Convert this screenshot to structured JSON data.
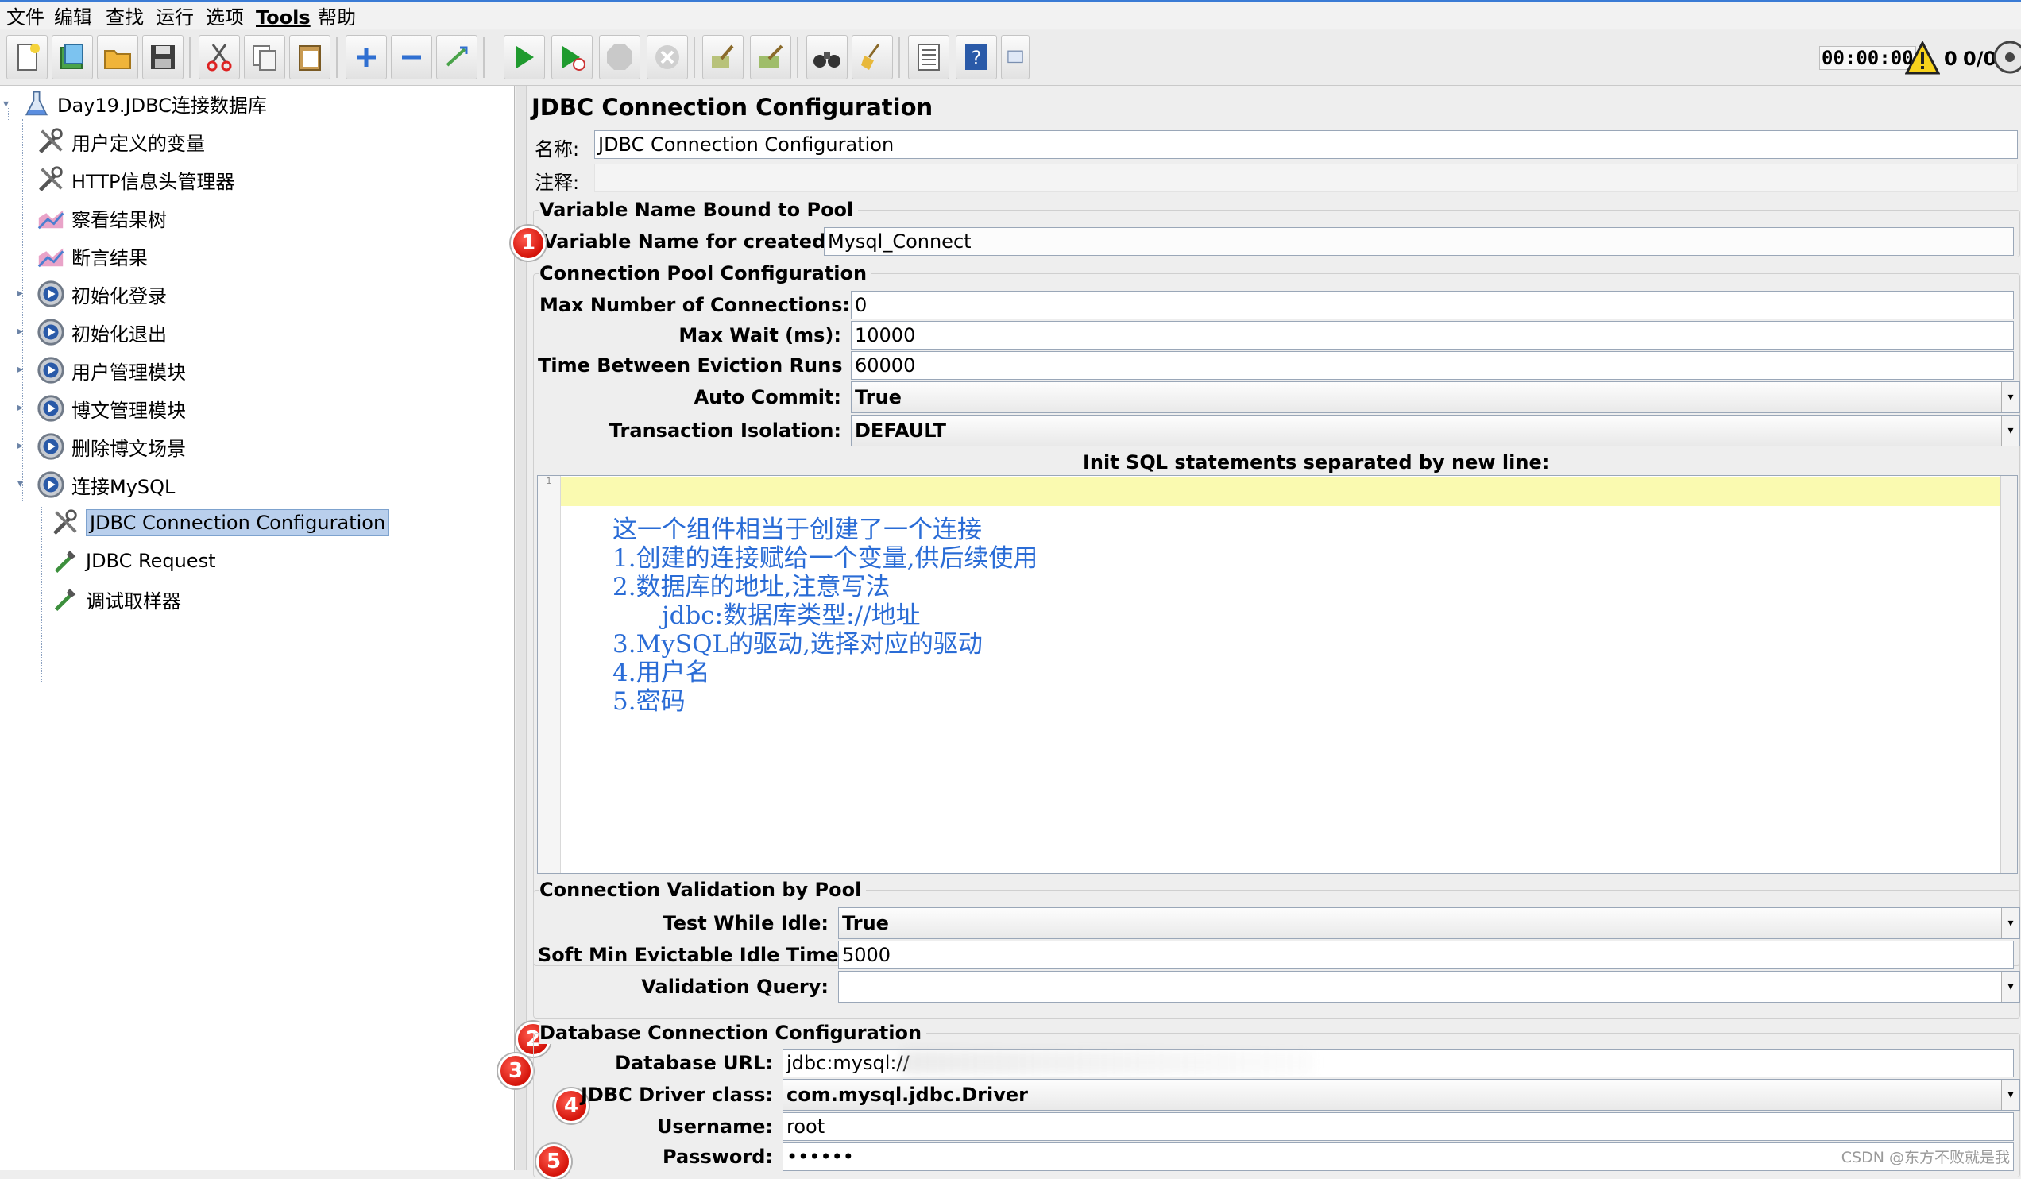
{
  "menu": [
    "文件",
    "编辑",
    "查找",
    "运行",
    "选项",
    "Tools",
    "帮助"
  ],
  "toolbar": {
    "timer": "00:00:00",
    "warning_count": "0",
    "thread_count": "0/0"
  },
  "tree": {
    "root": "Day19.JDBC连接数据库",
    "items": [
      {
        "label": "用户定义的变量",
        "icon": "wrench-icon"
      },
      {
        "label": "HTTP信息头管理器",
        "icon": "wrench-icon"
      },
      {
        "label": "察看结果树",
        "icon": "graph-icon"
      },
      {
        "label": "断言结果",
        "icon": "graph-icon"
      },
      {
        "label": "初始化登录",
        "icon": "gear-icon"
      },
      {
        "label": "初始化退出",
        "icon": "gear-icon"
      },
      {
        "label": "用户管理模块",
        "icon": "gear-icon"
      },
      {
        "label": "博文管理模块",
        "icon": "gear-icon"
      },
      {
        "label": "删除博文场景",
        "icon": "gear-icon"
      },
      {
        "label": "连接MySQL",
        "icon": "gear-icon"
      }
    ],
    "children": [
      {
        "label": "JDBC Connection Configuration",
        "icon": "wrench-icon",
        "selected": true
      },
      {
        "label": "JDBC Request",
        "icon": "pipette-icon"
      },
      {
        "label": "调试取样器",
        "icon": "pipette-icon"
      }
    ]
  },
  "panel": {
    "title": "JDBC Connection Configuration",
    "name_label": "名称:",
    "name_value": "JDBC Connection Configuration",
    "comment_label": "注释:",
    "comment_value": "",
    "var_group": "Variable Name Bound to Pool",
    "var_label": "Variable Name for created pool:",
    "var_value": "Mysql_Connect",
    "pool_group": "Connection Pool Configuration",
    "max_conn_label": "Max Number of Connections:",
    "max_conn_value": "0",
    "max_wait_label": "Max Wait (ms):",
    "max_wait_value": "10000",
    "eviction_label": "Time Between Eviction Runs (ms):",
    "eviction_value": "60000",
    "auto_commit_label": "Auto Commit:",
    "auto_commit_value": "True",
    "isolation_label": "Transaction Isolation:",
    "isolation_value": "DEFAULT",
    "init_sql_label": "Init SQL statements separated by new line:",
    "sql_line_no": "1",
    "notes": [
      "这一个组件相当于创建了一个连接",
      "1.创建的连接赋给一个变量,供后续使用",
      "2.数据库的地址,注意写法",
      "jdbc:数据库类型://地址",
      "3.MySQL的驱动,选择对应的驱动",
      "4.用户名",
      "5.密码"
    ],
    "validation_group": "Connection Validation by Pool",
    "test_idle_label": "Test While Idle:",
    "test_idle_value": "True",
    "soft_min_label": "Soft Min Evictable Idle Time(ms):",
    "soft_min_value": "5000",
    "validation_query_label": "Validation Query:",
    "validation_query_value": "",
    "db_group": "Database Connection Configuration",
    "db_url_label": "Database URL:",
    "db_url_value": "jdbc:mysql://",
    "driver_label": "JDBC Driver class:",
    "driver_value": "com.mysql.jdbc.Driver",
    "username_label": "Username:",
    "username_value": "root",
    "password_label": "Password:",
    "password_value": "••••••",
    "badges": [
      "1",
      "2",
      "3",
      "4",
      "5"
    ]
  },
  "watermark": "CSDN @东方不败就是我",
  "colors": {
    "note": "#2a6cd6",
    "badge": "#d4140a",
    "selection": "#b9cfec"
  }
}
